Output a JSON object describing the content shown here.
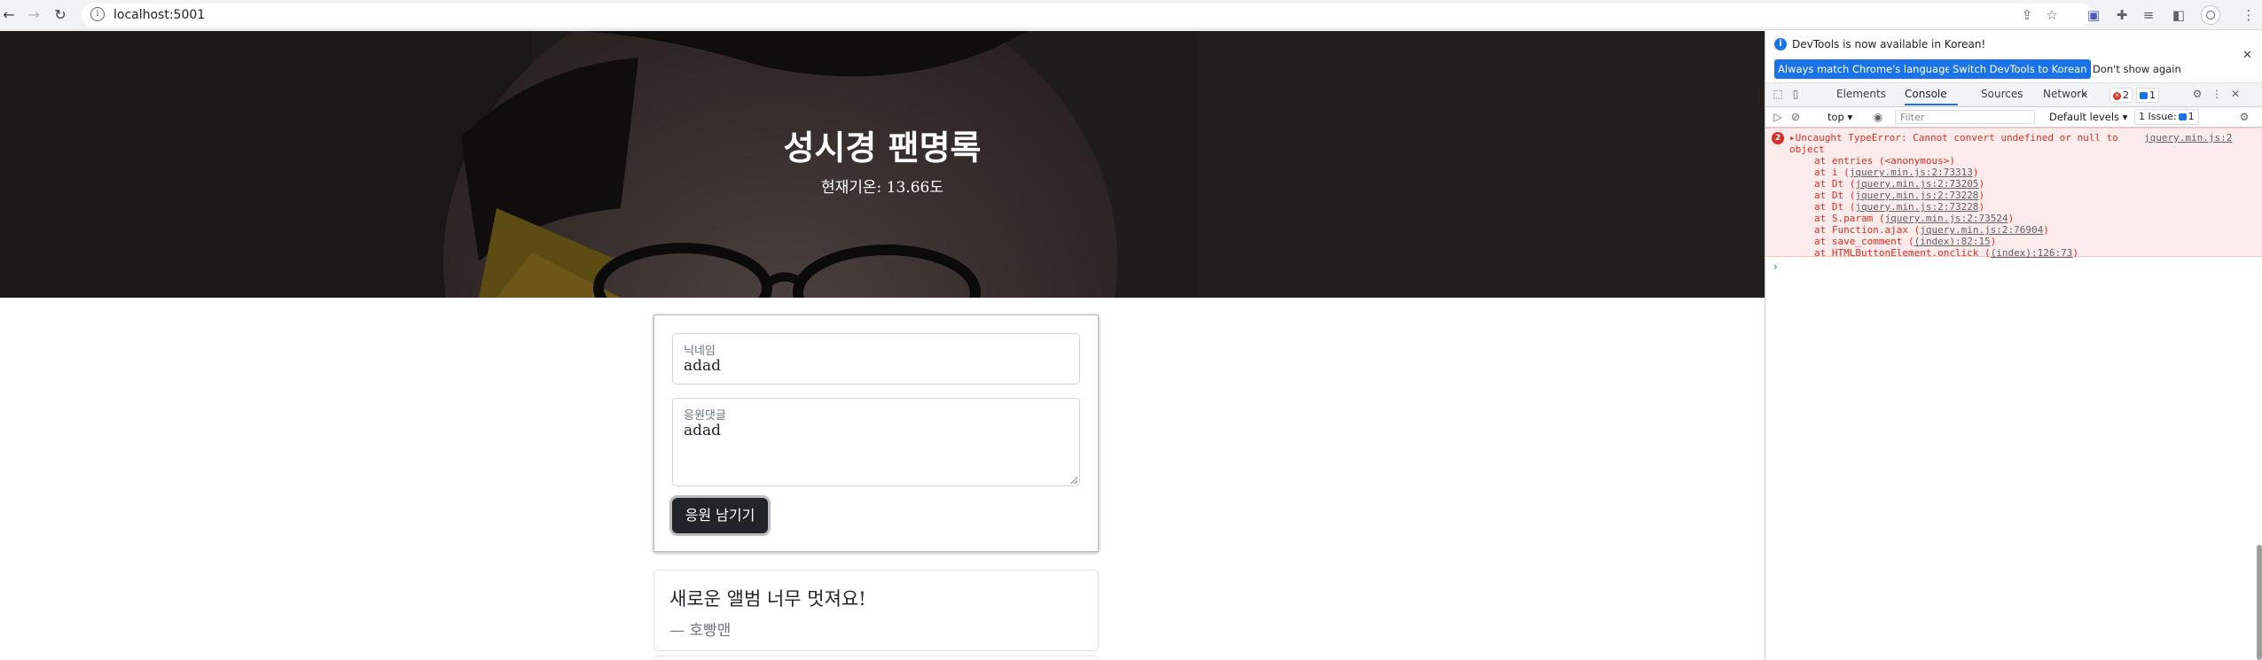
{
  "browser": {
    "url": "localhost:5001"
  },
  "page": {
    "title": "성시경 팬명록",
    "temperature": "현재기온: 13.66도",
    "form": {
      "nickname_label": "닉네임",
      "nickname_value": "adad",
      "comment_label": "응원댓글",
      "comment_value": "adad",
      "submit_label": "응원 남기기"
    },
    "comments": [
      {
        "text": "새로운 앨범 너무 멋져요!",
        "author": "— 호빵맨"
      }
    ]
  },
  "devtools": {
    "infobar": {
      "message": "DevTools is now available in Korean!",
      "btn_match": "Always match Chrome's language",
      "btn_switch": "Switch DevTools to Korean",
      "btn_dismiss": "Don't show again"
    },
    "tabs": [
      "Elements",
      "Console",
      "Sources",
      "Network"
    ],
    "active_tab": "Console",
    "more_tabs": "»",
    "error_count": "2",
    "message_count": "1",
    "context": "top ▾",
    "filter_placeholder": "Filter",
    "levels": "Default levels ▾",
    "issues": "1 Issue:",
    "issues_count": "1",
    "error": {
      "count": "2",
      "message_line1": "▸Uncaught TypeError: Cannot convert undefined or null to",
      "message_line2": "object",
      "source": "jquery.min.js:2",
      "stack": [
        {
          "prefix": "at entries (<anonymous>)",
          "link": "",
          "suffix": ""
        },
        {
          "prefix": "at i (",
          "link": "jquery.min.js:2:73313",
          "suffix": ")"
        },
        {
          "prefix": "at Dt (",
          "link": "jquery.min.js:2:73205",
          "suffix": ")"
        },
        {
          "prefix": "at Dt (",
          "link": "jquery.min.js:2:73228",
          "suffix": ")"
        },
        {
          "prefix": "at Dt (",
          "link": "jquery.min.js:2:73228",
          "suffix": ")"
        },
        {
          "prefix": "at S.param (",
          "link": "jquery.min.js:2:73524",
          "suffix": ")"
        },
        {
          "prefix": "at Function.ajax (",
          "link": "jquery.min.js:2:76904",
          "suffix": ")"
        },
        {
          "prefix": "at save_comment (",
          "link": "(index):82:15",
          "suffix": ")"
        },
        {
          "prefix": "at HTMLButtonElement.onclick (",
          "link": "(index):126:73",
          "suffix": ")"
        }
      ]
    },
    "prompt": "›"
  },
  "colors": {
    "accent": "#1a73e8",
    "error": "#d93025",
    "dark_button": "#212529"
  }
}
